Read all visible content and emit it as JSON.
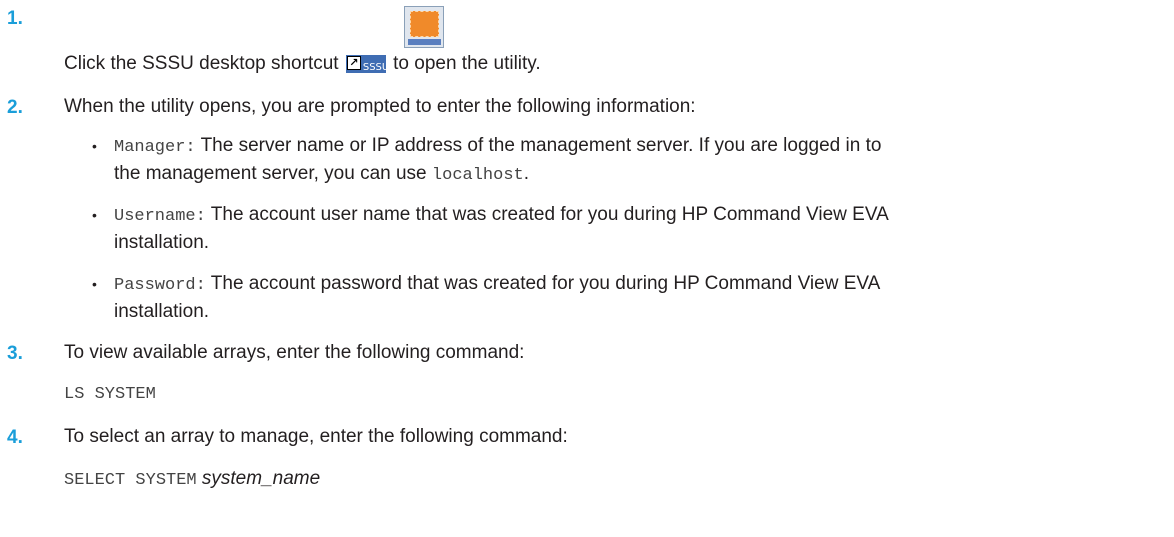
{
  "steps": [
    {
      "number": "1.",
      "pre": "Click the SSSU desktop shortcut",
      "post": "to open the utility.",
      "icon_label": "SSSU"
    },
    {
      "number": "2.",
      "text": "When the utility opens, you are prompted to enter the following information:",
      "bullets": [
        {
          "term": "Manager:",
          "text1": "The server name or IP address of the management server. If you are logged in to",
          "text2a": "the management server, you can use",
          "code": "localhost",
          "text2b": "."
        },
        {
          "term": "Username:",
          "text1": "The account user name that was created for you during HP Command View EVA",
          "text2": "installation."
        },
        {
          "term": "Password:",
          "text1": "The account password that was created for you during HP Command View EVA",
          "text2": "installation."
        }
      ]
    },
    {
      "number": "3.",
      "text": "To view available arrays, enter the following command:",
      "command": "LS SYSTEM"
    },
    {
      "number": "4.",
      "text": "To select an array to manage, enter the following command:",
      "command": "SELECT SYSTEM",
      "argument": "system_name"
    }
  ]
}
